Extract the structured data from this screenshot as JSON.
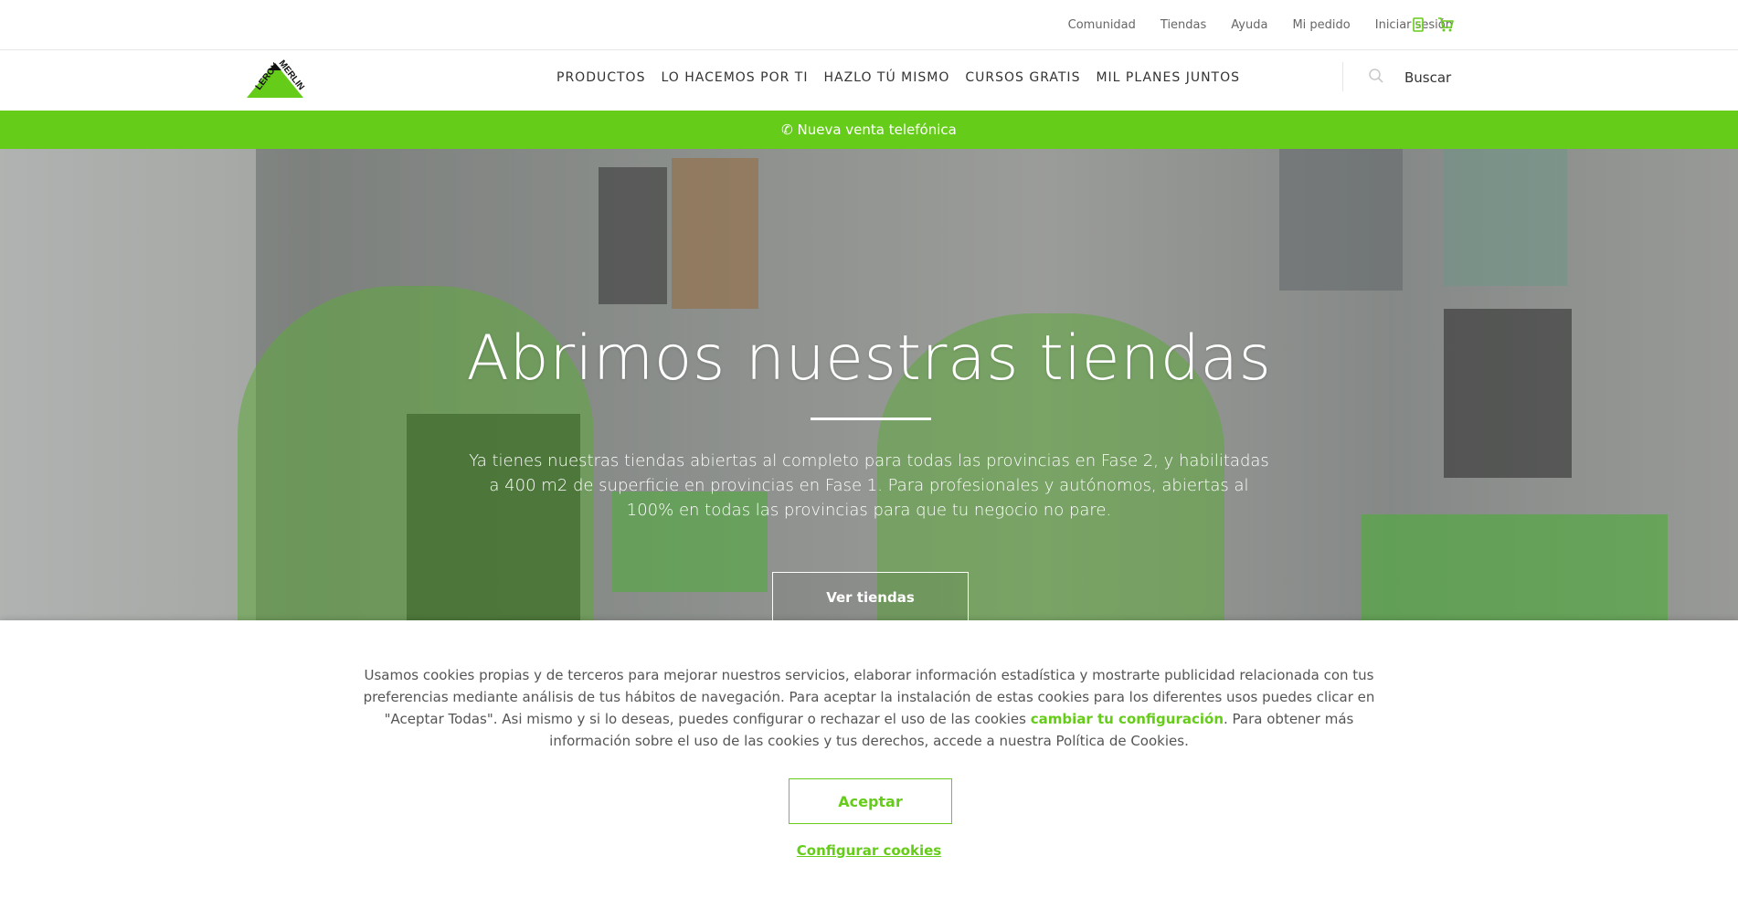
{
  "utility": {
    "links": [
      "Comunidad",
      "Tiendas",
      "Ayuda",
      "Mi pedido",
      "Iniciar sesión"
    ],
    "icons": [
      "shopping-list-icon",
      "cart-icon"
    ]
  },
  "brand": {
    "logo_text": "LEROY MERLIN",
    "accent_color": "#66cc1a"
  },
  "nav": {
    "items": [
      "PRODUCTOS",
      "LO HACEMOS POR TI",
      "HAZLO TÚ MISMO",
      "CURSOS GRATIS",
      "MIL PLANES JUNTOS"
    ],
    "search_label": "Buscar"
  },
  "promo": {
    "text": "✆ Nueva venta telefónica"
  },
  "hero": {
    "title": "Abrimos nuestras tiendas",
    "text": "Ya tienes nuestras tiendas abiertas al completo para todas las provincias en Fase 2, y habilitadas a 400 m2 de superficie en provincias en Fase 1. Para profesionales y autónomos, abiertas al 100% en todas las provincias para que tu negocio no pare.",
    "cta": "Ver tiendas"
  },
  "cookies": {
    "text_before": "Usamos cookies propias y de terceros para mejorar nuestros servicios, elaborar información estadística y mostrarte publicidad relacionada con tus preferencias mediante análisis de tus hábitos de navegación. Para aceptar la instalación de estas cookies para los diferentes usos puedes clicar en \"Aceptar Todas\". Asi mismo y si lo deseas, puedes configurar o rechazar el uso  de las cookies ",
    "link": "cambiar tu configuración",
    "text_after": ". Para obtener más información sobre el uso de las cookies y tus derechos, accede a nuestra Política de Cookies.",
    "accept": "Aceptar",
    "configure": "Configurar cookies"
  }
}
